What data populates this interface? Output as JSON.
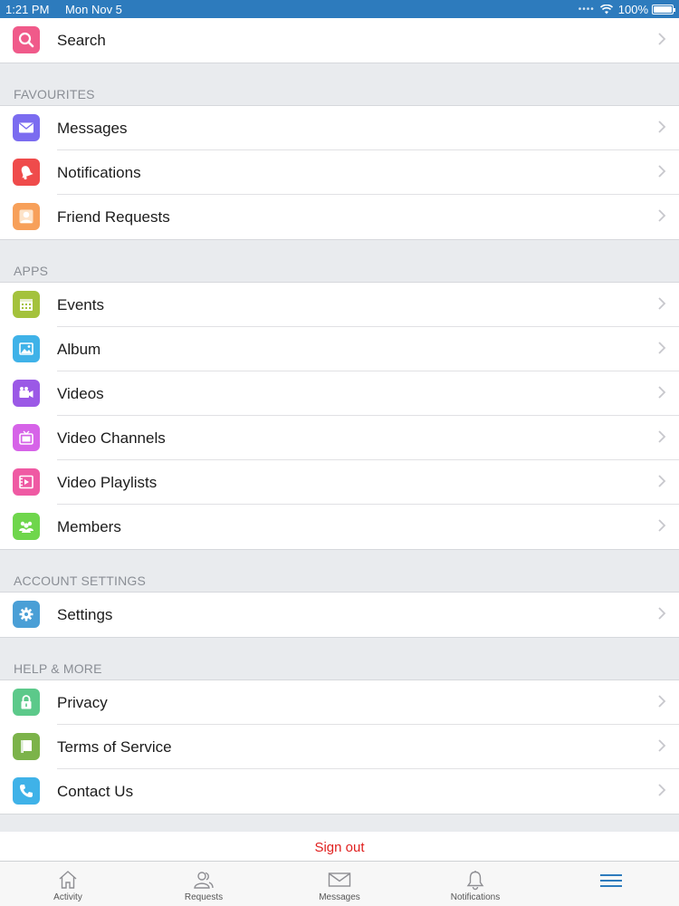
{
  "status": {
    "time": "1:21 PM",
    "date": "Mon Nov 5",
    "battery": "100%"
  },
  "search": {
    "label": "Search",
    "icon": "search-icon",
    "color": "#f05a8a"
  },
  "sections": {
    "favourites": {
      "title": "FAVOURITES",
      "items": [
        {
          "label": "Messages",
          "icon": "envelope-icon",
          "color": "#7b6cf0"
        },
        {
          "label": "Notifications",
          "icon": "bell-icon",
          "color": "#ef4b4b"
        },
        {
          "label": "Friend Requests",
          "icon": "user-icon",
          "color": "#f7a05a"
        }
      ]
    },
    "apps": {
      "title": "APPS",
      "items": [
        {
          "label": "Events",
          "icon": "calendar-icon",
          "color": "#a4c23c"
        },
        {
          "label": "Album",
          "icon": "image-icon",
          "color": "#3fb2e8"
        },
        {
          "label": "Videos",
          "icon": "video-camera-icon",
          "color": "#9b59e6"
        },
        {
          "label": "Video Channels",
          "icon": "tv-icon",
          "color": "#d663e8"
        },
        {
          "label": "Video Playlists",
          "icon": "playlist-icon",
          "color": "#ef5aa3"
        },
        {
          "label": "Members",
          "icon": "group-icon",
          "color": "#6fd64c"
        }
      ]
    },
    "account": {
      "title": "ACCOUNT SETTINGS",
      "items": [
        {
          "label": "Settings",
          "icon": "gear-icon",
          "color": "#4a9fd6"
        }
      ]
    },
    "help": {
      "title": "HELP & MORE",
      "items": [
        {
          "label": "Privacy",
          "icon": "lock-icon",
          "color": "#5cc98a"
        },
        {
          "label": "Terms of Service",
          "icon": "book-icon",
          "color": "#7cb34a"
        },
        {
          "label": "Contact Us",
          "icon": "phone-icon",
          "color": "#3fb2e8"
        }
      ]
    }
  },
  "signout": {
    "label": "Sign out",
    "color": "#e0201f"
  },
  "tabbar": {
    "items": [
      {
        "label": "Activity",
        "icon": "home-icon"
      },
      {
        "label": "Requests",
        "icon": "users-icon"
      },
      {
        "label": "Messages",
        "icon": "envelope-icon"
      },
      {
        "label": "Notifications",
        "icon": "bell-icon"
      },
      {
        "label": "",
        "icon": "menu-icon",
        "active": true,
        "color": "#2d7bbd"
      }
    ]
  }
}
